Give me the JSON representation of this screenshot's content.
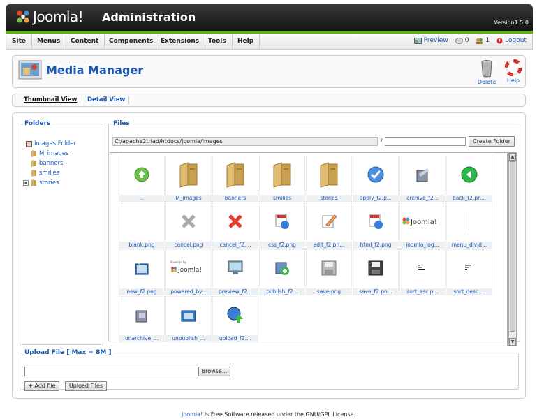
{
  "header": {
    "logo_text": "Joomla!",
    "admin_title": "Administration",
    "version": "Version1.5.0"
  },
  "menu": {
    "items": [
      "Site",
      "Menus",
      "Content",
      "Components",
      "Extensions",
      "Tools",
      "Help"
    ],
    "preview": "Preview",
    "messages": "0",
    "users": "1",
    "logout": "Logout"
  },
  "toolbar": {
    "title": "Media Manager",
    "delete": "Delete",
    "help": "Help"
  },
  "views": {
    "thumbnail": "Thumbnail View",
    "detail": "Detail View"
  },
  "folders": {
    "legend": "Folders",
    "root": "Images Folder",
    "children": [
      "M_images",
      "banners",
      "smilies",
      "stories"
    ]
  },
  "files": {
    "legend": "Files",
    "path": "C:/apache2triad/htdocs/joomla/images",
    "slash": "/",
    "create_folder": "Create Folder",
    "items": [
      {
        "label": "..",
        "icon": "up"
      },
      {
        "label": "M_images",
        "icon": "folder"
      },
      {
        "label": "banners",
        "icon": "folder"
      },
      {
        "label": "smilies",
        "icon": "folder"
      },
      {
        "label": "stories",
        "icon": "folder"
      },
      {
        "label": "apply_f2.p...",
        "icon": "apply"
      },
      {
        "label": "archive_f2...",
        "icon": "archive"
      },
      {
        "label": "back_f2.pn...",
        "icon": "back"
      },
      {
        "label": "blank.png",
        "icon": "blank"
      },
      {
        "label": "cancel.png",
        "icon": "cancel-grey"
      },
      {
        "label": "cancel_f2....",
        "icon": "cancel-red"
      },
      {
        "label": "css_f2.png",
        "icon": "css"
      },
      {
        "label": "edit_f2.pn...",
        "icon": "edit"
      },
      {
        "label": "html_f2.png",
        "icon": "html"
      },
      {
        "label": "joomla_log...",
        "icon": "joomla-logo"
      },
      {
        "label": "menu_divid...",
        "icon": "divider"
      },
      {
        "label": "new_f2.png",
        "icon": "new"
      },
      {
        "label": "powered_by...",
        "icon": "powered"
      },
      {
        "label": "preview_f2...",
        "icon": "preview"
      },
      {
        "label": "publish_f2...",
        "icon": "publish"
      },
      {
        "label": "save.png",
        "icon": "save-grey"
      },
      {
        "label": "save_f2.pn...",
        "icon": "save"
      },
      {
        "label": "sort_asc.p...",
        "icon": "sort-asc"
      },
      {
        "label": "sort_desc....",
        "icon": "sort-desc"
      },
      {
        "label": "unarchive_...",
        "icon": "unarchive"
      },
      {
        "label": "unpublish_...",
        "icon": "unpublish"
      },
      {
        "label": "upload_f2....",
        "icon": "upload"
      }
    ]
  },
  "upload": {
    "legend": "Upload File [ Max = 8M ]",
    "browse": "Browse...",
    "add_file": "+ Add file",
    "upload_files": "Upload Files"
  },
  "footer": {
    "link": "Joomla!",
    "text": " is Free Software released under the GNU/GPL License."
  }
}
